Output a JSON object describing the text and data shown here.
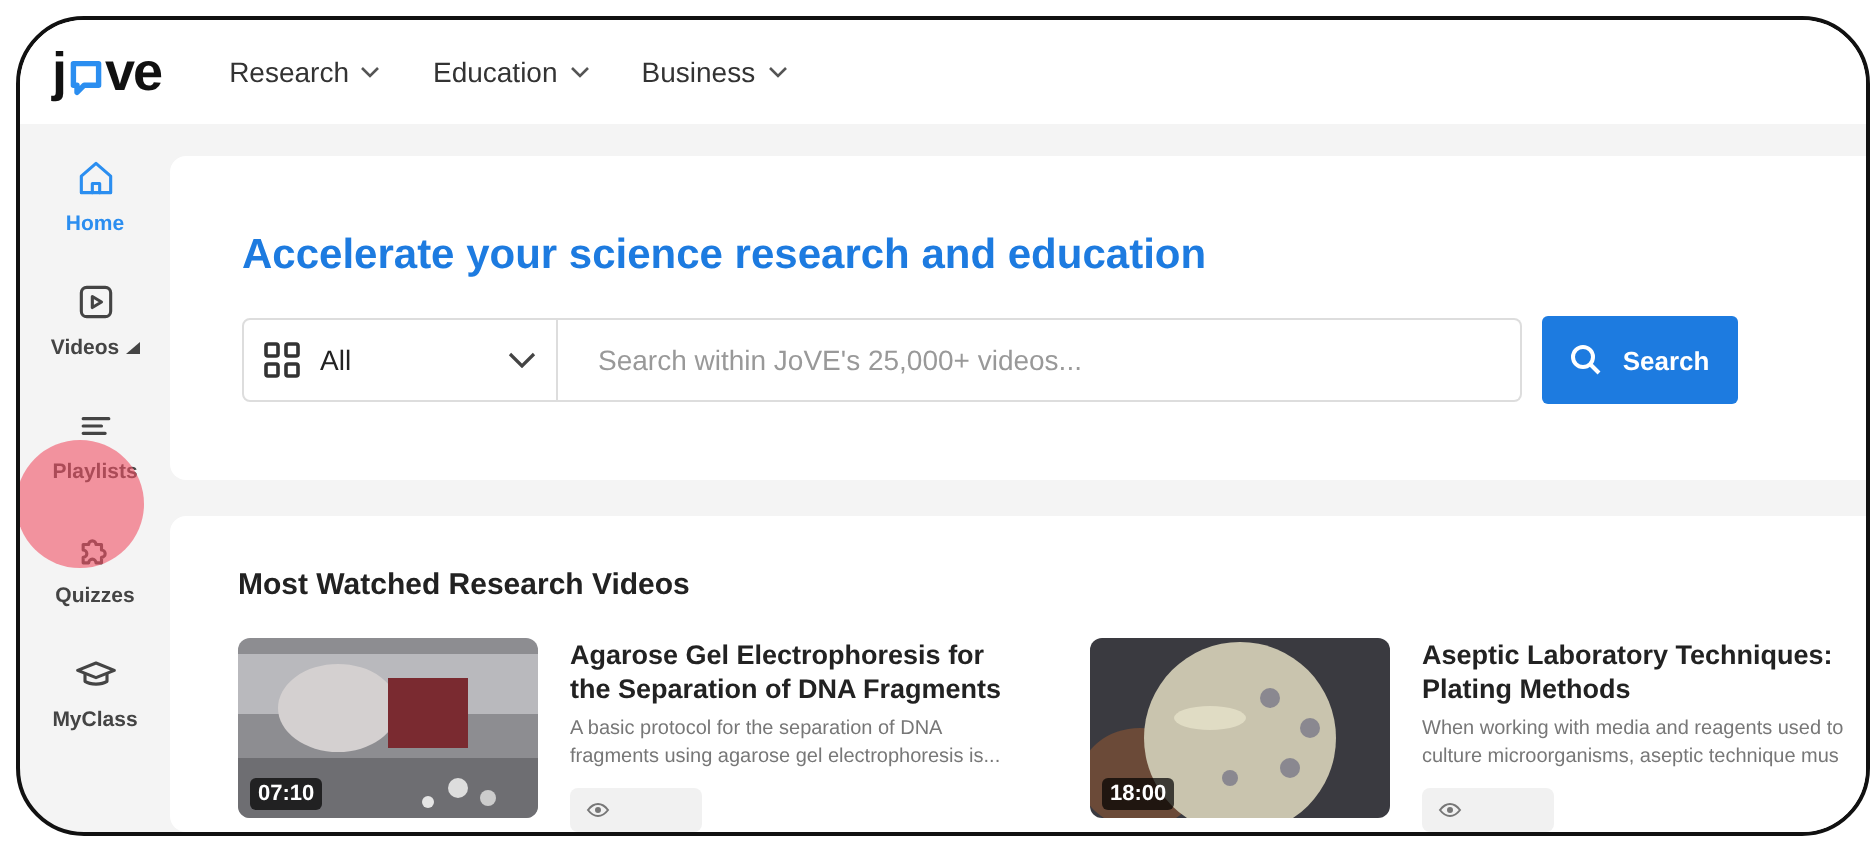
{
  "header": {
    "logo": {
      "before": "j",
      "after": "ve"
    },
    "nav": [
      {
        "label": "Research"
      },
      {
        "label": "Education"
      },
      {
        "label": "Business"
      }
    ]
  },
  "sidebar": {
    "items": [
      {
        "label": "Home",
        "kind": "home",
        "selected": true,
        "caret": false
      },
      {
        "label": "Videos",
        "kind": "play",
        "selected": false,
        "caret": true
      },
      {
        "label": "Playlists",
        "kind": "list",
        "selected": false,
        "caret": false
      },
      {
        "label": "Quizzes",
        "kind": "puzzle",
        "selected": false,
        "caret": false
      },
      {
        "label": "MyClass",
        "kind": "cap",
        "selected": false,
        "caret": false
      }
    ]
  },
  "hero": {
    "title": "Accelerate your science research and education",
    "category": "All",
    "placeholder": "Search within JoVE's 25,000+ videos...",
    "button": "Search"
  },
  "videos": {
    "heading": "Most Watched Research Videos",
    "items": [
      {
        "title": "Agarose Gel Electrophoresis for the Separation of DNA Fragments",
        "description": "A basic protocol for the separation of DNA fragments using agarose gel electrophoresis is...",
        "duration": "07:10"
      },
      {
        "title": "Aseptic Laboratory Techniques: Plating Methods",
        "description": "When working with media and reagents used to culture microorganisms, aseptic technique mus",
        "duration": "18:00"
      }
    ]
  }
}
